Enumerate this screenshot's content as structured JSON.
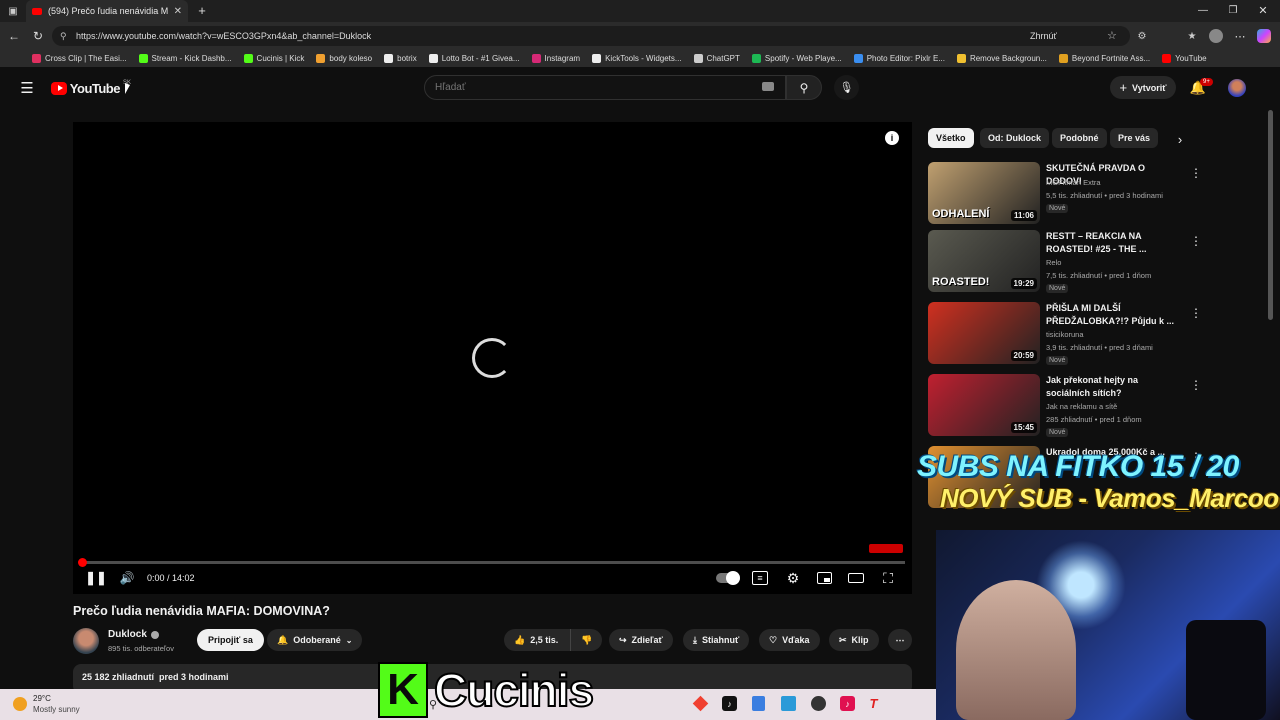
{
  "browser": {
    "tab_title": "(594) Prečo ľudia nenávidia MAFI...",
    "url": "https://www.youtube.com/watch?v=wESCO3GPxn4&ab_channel=Duklock",
    "zoom_label": "Zhrnúť",
    "bookmarks": [
      {
        "label": "Cross Clip | The Easi...",
        "color": "#e03060"
      },
      {
        "label": "Stream - Kick Dashb...",
        "color": "#53fc18"
      },
      {
        "label": "Cucinis | Kick",
        "color": "#53fc18"
      },
      {
        "label": "body koleso",
        "color": "#f0a030"
      },
      {
        "label": "botrix",
        "color": "#eeeeee"
      },
      {
        "label": "Lotto Bot - #1 Givea...",
        "color": "#eeeeee"
      },
      {
        "label": "Instagram",
        "color": "#d62976"
      },
      {
        "label": "KickTools - Widgets...",
        "color": "#eeeeee"
      },
      {
        "label": "ChatGPT",
        "color": "#cccccc"
      },
      {
        "label": "Spotify - Web Playe...",
        "color": "#1db954"
      },
      {
        "label": "Photo Editor: Pixlr E...",
        "color": "#3a8ef0"
      },
      {
        "label": "Remove Backgroun...",
        "color": "#f0c030"
      },
      {
        "label": "Beyond Fortnite Ass...",
        "color": "#e0a020"
      },
      {
        "label": "YouTube",
        "color": "#ff0000"
      }
    ]
  },
  "youtube": {
    "logo_text": "YouTube",
    "region": "SK",
    "search_placeholder": "Hľadať",
    "create_label": "Vytvoriť",
    "notif_count": "9+"
  },
  "player": {
    "time": "0:00 / 14:02",
    "progress_fraction": 0.0
  },
  "video": {
    "title": "Prečo ľudia nenávidia MAFIA: DOMOVINA?",
    "channel": "Duklock",
    "subscribers": "895 tis. odberateľov",
    "join_label": "Pripojiť sa",
    "subscribed_label": "Odoberané",
    "likes": "2,5 tis.",
    "share_label": "Zdieľať",
    "download_label": "Stiahnuť",
    "thanks_label": "Vďaka",
    "clip_label": "Klip",
    "views_line": "25 182 zhliadnutí  pred 3 hodinami"
  },
  "chips": [
    "Všetko",
    "Od: Duklock",
    "Podobné",
    "Pre vás"
  ],
  "recommendations": [
    {
      "title": "SKUTEČNÁ PRAVDA O DODOVI",
      "channel": "MGFitman Extra",
      "meta": "5,5 tis. zhliadnutí • pred 3 hodinami",
      "badge": "Nové",
      "duration": "11:06",
      "thumb_text": "ODHALENÍ",
      "thumb_color": "#c0a070"
    },
    {
      "title": "RESTT – REAKCIA NA ROASTED! #25 - THE ...",
      "channel": "Relo",
      "meta": "7,5 tis. zhliadnutí • pred 1 dňom",
      "badge": "Nové",
      "duration": "19:29",
      "thumb_text": "ROASTED!",
      "thumb_color": "#5a5a50"
    },
    {
      "title": "PŘIŠLA MI DALŠÍ PŘEDŽALOBKA?!? Půjdu k ...",
      "channel": "tisicikoruna",
      "meta": "3,9 tis. zhliadnutí • pred 3 dňami",
      "badge": "Nové",
      "duration": "20:59",
      "thumb_text": "",
      "thumb_color": "#d03020"
    },
    {
      "title": "Jak překonat hejty na sociálních sítích?",
      "channel": "Jak na reklamu a sítě",
      "meta": "285 zhliadnutí • pred 1 dňom",
      "badge": "Nové",
      "duration": "15:45",
      "thumb_text": "",
      "thumb_color": "#c02030"
    },
    {
      "title": "Ukradol doma 25.000Kč a ...",
      "channel": "",
      "meta": "",
      "badge": "",
      "duration": "",
      "thumb_text": "",
      "thumb_color": "#e09030"
    }
  ],
  "overlays": {
    "subs_goal": "SUBS NA FITKO 15 / 20",
    "new_sub": "NOVÝ SUB - Vamos_Marcoo",
    "kick_letter": "K",
    "streamer_name": "Cucinis"
  },
  "taskbar": {
    "temp": "29°C",
    "weather": "Mostly sunny"
  }
}
